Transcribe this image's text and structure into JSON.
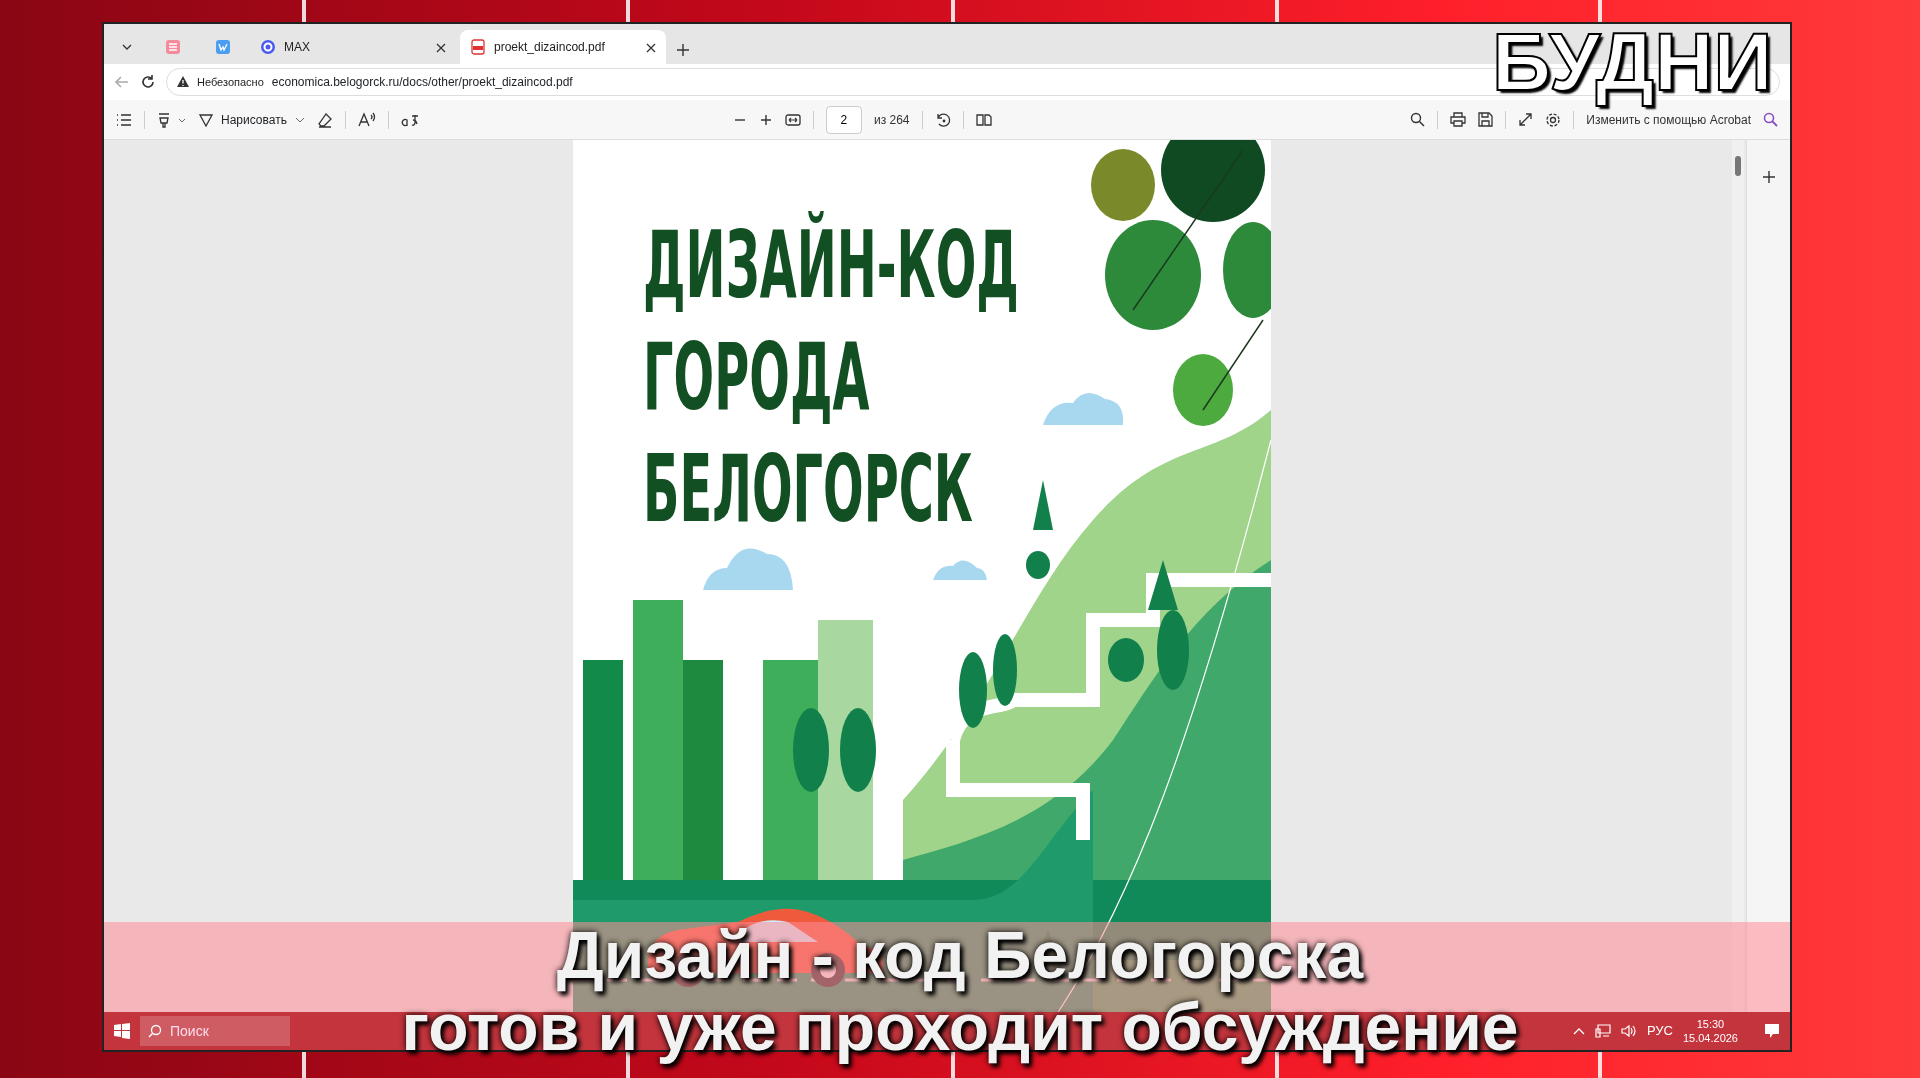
{
  "browser": {
    "tabs": [
      {
        "kind": "pinned",
        "selected": false
      },
      {
        "kind": "pinned",
        "selected": false
      },
      {
        "kind": "labeled",
        "label": "MAX",
        "selected": false
      },
      {
        "kind": "labeled",
        "label": "proekt_dizaincod.pdf",
        "selected": true
      }
    ],
    "address": {
      "security": "Небезопасно",
      "url": "economica.belogorck.ru/docs/other/proekt_dizaincod.pdf"
    }
  },
  "pdf_toolbar": {
    "draw_label": "Нарисовать",
    "page": "2",
    "page_total": "из 264",
    "acrobat_label": "Изменить с помощью Acrobat"
  },
  "document": {
    "title_lines": [
      "ДИЗАЙН-КОД",
      "ГОРОДА",
      "БЕЛОГОРСК"
    ]
  },
  "taskbar": {
    "search": {
      "placeholder": "Поиск"
    },
    "language": "РУС",
    "time": "15:30",
    "date": "15.04.2026"
  },
  "overlay": {
    "logo": "БУДНИ",
    "caption_lines": [
      "Дизайн - код Белогорска",
      "готов и уже проходит обсуждение"
    ]
  }
}
